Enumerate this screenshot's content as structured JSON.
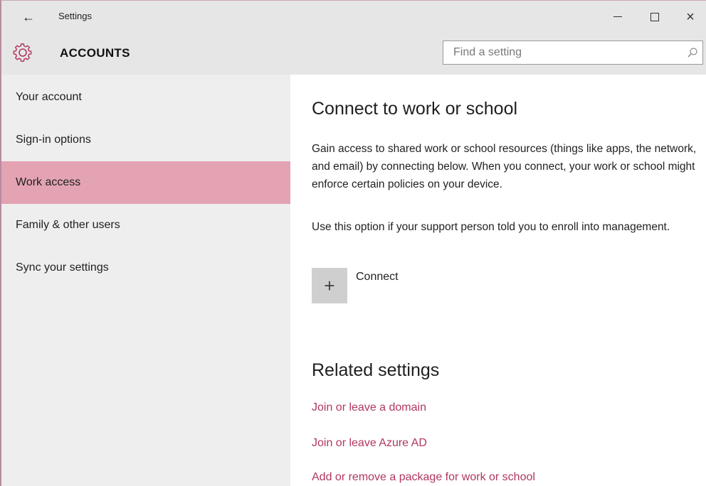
{
  "window": {
    "title": "Settings",
    "back_icon": "←",
    "close_icon": "×"
  },
  "header": {
    "section_title": "ACCOUNTS",
    "gear_icon": "gear-icon",
    "search": {
      "placeholder": "Find a setting",
      "value": ""
    }
  },
  "sidebar": {
    "items": [
      {
        "label": "Your account",
        "selected": false
      },
      {
        "label": "Sign-in options",
        "selected": false
      },
      {
        "label": "Work access",
        "selected": true
      },
      {
        "label": "Family & other users",
        "selected": false
      },
      {
        "label": "Sync your settings",
        "selected": false
      }
    ]
  },
  "content": {
    "heading": "Connect to work or school",
    "description": "Gain access to shared work or school resources (things like apps, the network, and email) by connecting below. When you connect, your work or school might enforce certain policies on your device.",
    "note": "Use this option if your support person told you to enroll into management.",
    "connect": {
      "icon": "+",
      "label": "Connect"
    },
    "related_heading": "Related settings",
    "related_links": [
      {
        "label": "Join or leave a domain"
      },
      {
        "label": "Join or leave Azure AD"
      },
      {
        "label": "Add or remove a package for work or school"
      }
    ]
  },
  "colors": {
    "accent": "#b0375f",
    "selected_bg": "#e3a3b3",
    "sidebar_bg": "#eeeeee",
    "header_bg": "#e6e6e6"
  }
}
